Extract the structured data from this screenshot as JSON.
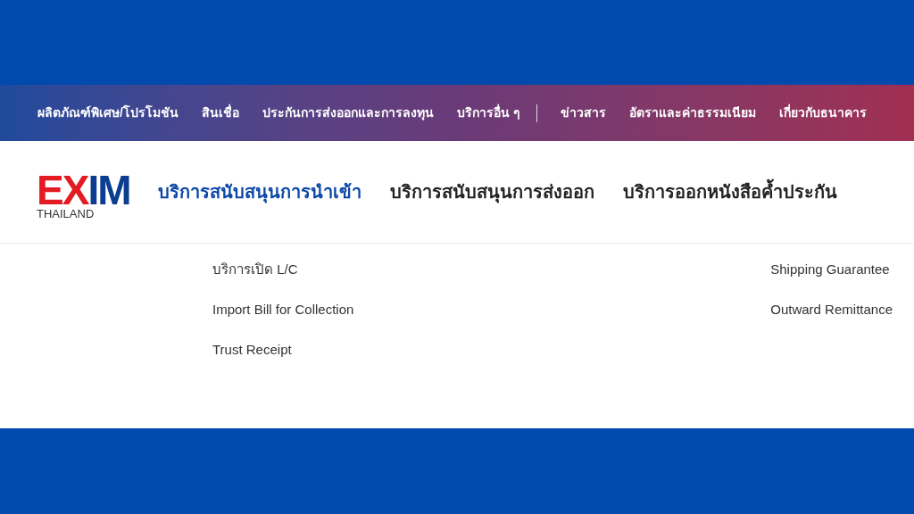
{
  "top_nav": [
    {
      "label": "ผลิตภัณฑ์พิเศษ/โปรโมชัน",
      "divider_after": false
    },
    {
      "label": "สินเชื่อ",
      "divider_after": false
    },
    {
      "label": "ประกันการส่งออกและการลงทุน",
      "divider_after": false
    },
    {
      "label": "บริการอื่น ๆ",
      "divider_after": true
    },
    {
      "label": "ข่าวสาร",
      "divider_after": false
    },
    {
      "label": "อัตราและค่าธรรมเนียม",
      "divider_after": false
    },
    {
      "label": "เกี่ยวกับธนาคาร",
      "divider_after": false
    }
  ],
  "logo": {
    "mark_left": "EX",
    "mark_right": "IM",
    "tagline": "THAILAND"
  },
  "main_nav": [
    {
      "label": "บริการสนับสนุนการนำเข้า",
      "selected": true
    },
    {
      "label": "บริการสนับสนุนการส่งออก",
      "selected": false
    },
    {
      "label": "บริการออกหนังสือค้ำประกัน",
      "selected": false
    }
  ],
  "dropdown": {
    "columns": [
      [
        "บริการเปิด L/C",
        "Import Bill for Collection",
        "Trust Receipt"
      ],
      [
        "Shipping Guarantee",
        "Outward Remittance"
      ]
    ]
  }
}
